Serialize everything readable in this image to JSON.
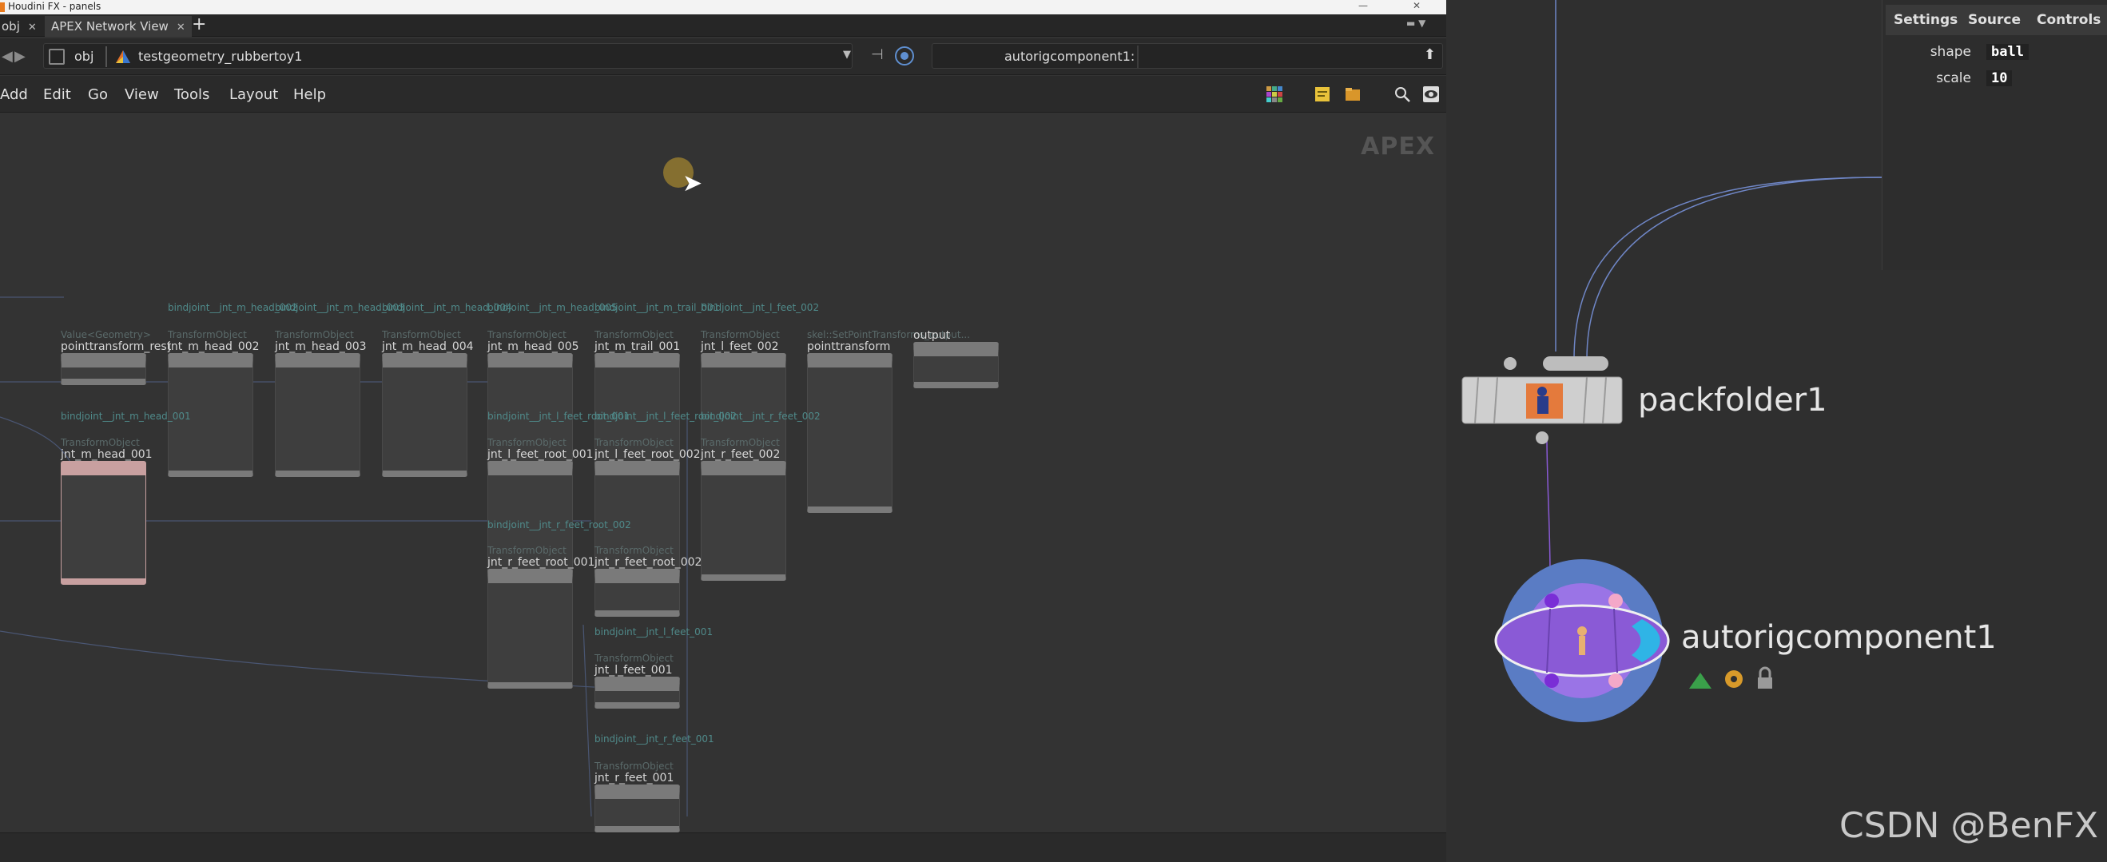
{
  "window": {
    "title": "Houdini FX - panels"
  },
  "tabs": [
    {
      "label": "obj",
      "closable": true
    },
    {
      "label": "APEX Network View",
      "closable": true
    }
  ],
  "path": {
    "root": "obj",
    "geometry": "testgeometry_rubbertoy1"
  },
  "node_field": {
    "label": "autorigcomponent1:"
  },
  "menu": [
    "Add",
    "Edit",
    "Go",
    "View",
    "Tools",
    "Layout",
    "Help"
  ],
  "canvas": {
    "badge": "APEX"
  },
  "apex_nodes": [
    {
      "category": "Value<Geometry>",
      "name": "pointtransform_rest"
    },
    {
      "category": "TransformObject",
      "name": "jnt_m_head_002"
    },
    {
      "category": "TransformObject",
      "name": "jnt_m_head_003"
    },
    {
      "category": "TransformObject",
      "name": "jnt_m_head_004"
    },
    {
      "category": "TransformObject",
      "name": "jnt_m_head_005"
    },
    {
      "category": "TransformObject",
      "name": "jnt_m_trail_001"
    },
    {
      "category": "TransformObject",
      "name": "jnt_l_feet_002"
    },
    {
      "category": "skel::SetPointTransforms_output...",
      "name": "pointtransform"
    },
    {
      "category": "",
      "name": "output"
    },
    {
      "category": "TransformObject",
      "name": "jnt_m_head_001"
    },
    {
      "category": "TransformObject",
      "name": "jnt_l_feet_root_001"
    },
    {
      "category": "TransformObject",
      "name": "jnt_l_feet_root_002"
    },
    {
      "category": "TransformObject",
      "name": "jnt_r_feet_002"
    },
    {
      "category": "TransformObject",
      "name": "jnt_r_feet_root_001"
    },
    {
      "category": "TransformObject",
      "name": "jnt_r_feet_root_002"
    },
    {
      "category": "TransformObject",
      "name": "jnt_l_feet_001"
    },
    {
      "category": "TransformObject",
      "name": "jnt_r_feet_001"
    }
  ],
  "bind_labels": [
    {
      "kind": "bind",
      "text": "bindjoint__jnt_m_head_002"
    },
    {
      "kind": "bind",
      "text": "bindjoint__jnt_m_head_003"
    },
    {
      "kind": "bind",
      "text": "bindjoint__jnt_m_head_004"
    },
    {
      "kind": "bind",
      "text": "bindjoint__jnt_m_head_005"
    },
    {
      "kind": "bind",
      "text": "bindjoint__jnt_m_trail_001"
    },
    {
      "kind": "bind",
      "text": "bindjoint__jnt_l_feet_002"
    },
    {
      "kind": "bind",
      "text": "bindjoint__jnt_m_head_001"
    },
    {
      "kind": "bind",
      "text": "bindjoint__jnt_l_feet_root_001"
    },
    {
      "kind": "bind",
      "text": "bindjoint__jnt_l_feet_root_002"
    },
    {
      "kind": "bind",
      "text": "bindjoint__jnt_r_feet_002"
    },
    {
      "kind": "bind",
      "text": "bindjoint__jnt_r_feet_root_002"
    },
    {
      "kind": "bind",
      "text": "bindjoint__jnt_l_feet_001"
    },
    {
      "kind": "bind",
      "text": "bindjoint__jnt_r_feet_001"
    }
  ],
  "parameters": {
    "tabs": [
      "Settings",
      "Source",
      "Controls"
    ],
    "rows": [
      {
        "label": "shape",
        "value": "ball"
      },
      {
        "label": "scale",
        "value": "10"
      }
    ]
  },
  "sop_nodes": {
    "packfolder": "packfolder1",
    "autorig": "autorigcomponent1"
  },
  "watermark": "CSDN @BenFX",
  "colors": {
    "accent_blue": "#5f8fd0",
    "autorig_purple": "#8a5ad6",
    "wire_blue": "#6f86c6"
  }
}
